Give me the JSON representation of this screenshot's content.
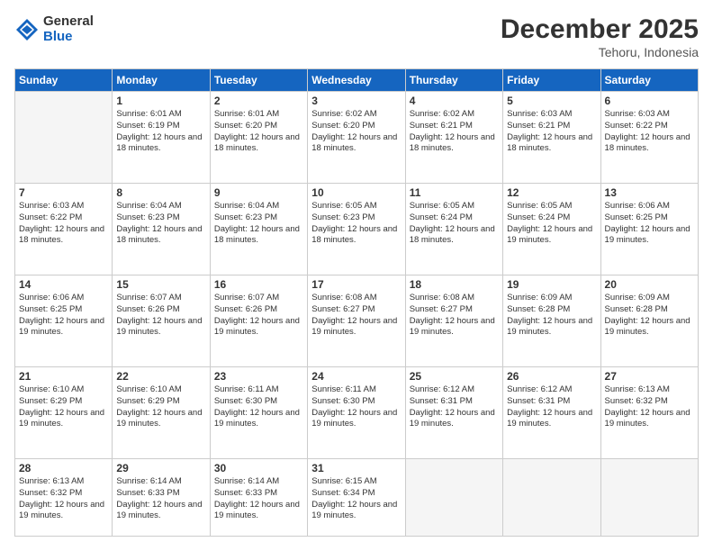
{
  "logo": {
    "general": "General",
    "blue": "Blue"
  },
  "header": {
    "month": "December 2025",
    "location": "Tehoru, Indonesia"
  },
  "days": [
    "Sunday",
    "Monday",
    "Tuesday",
    "Wednesday",
    "Thursday",
    "Friday",
    "Saturday"
  ],
  "weeks": [
    [
      {
        "num": "",
        "sunrise": "",
        "sunset": "",
        "daylight": ""
      },
      {
        "num": "1",
        "sunrise": "Sunrise: 6:01 AM",
        "sunset": "Sunset: 6:19 PM",
        "daylight": "Daylight: 12 hours and 18 minutes."
      },
      {
        "num": "2",
        "sunrise": "Sunrise: 6:01 AM",
        "sunset": "Sunset: 6:20 PM",
        "daylight": "Daylight: 12 hours and 18 minutes."
      },
      {
        "num": "3",
        "sunrise": "Sunrise: 6:02 AM",
        "sunset": "Sunset: 6:20 PM",
        "daylight": "Daylight: 12 hours and 18 minutes."
      },
      {
        "num": "4",
        "sunrise": "Sunrise: 6:02 AM",
        "sunset": "Sunset: 6:21 PM",
        "daylight": "Daylight: 12 hours and 18 minutes."
      },
      {
        "num": "5",
        "sunrise": "Sunrise: 6:03 AM",
        "sunset": "Sunset: 6:21 PM",
        "daylight": "Daylight: 12 hours and 18 minutes."
      },
      {
        "num": "6",
        "sunrise": "Sunrise: 6:03 AM",
        "sunset": "Sunset: 6:22 PM",
        "daylight": "Daylight: 12 hours and 18 minutes."
      }
    ],
    [
      {
        "num": "7",
        "sunrise": "Sunrise: 6:03 AM",
        "sunset": "Sunset: 6:22 PM",
        "daylight": "Daylight: 12 hours and 18 minutes."
      },
      {
        "num": "8",
        "sunrise": "Sunrise: 6:04 AM",
        "sunset": "Sunset: 6:23 PM",
        "daylight": "Daylight: 12 hours and 18 minutes."
      },
      {
        "num": "9",
        "sunrise": "Sunrise: 6:04 AM",
        "sunset": "Sunset: 6:23 PM",
        "daylight": "Daylight: 12 hours and 18 minutes."
      },
      {
        "num": "10",
        "sunrise": "Sunrise: 6:05 AM",
        "sunset": "Sunset: 6:23 PM",
        "daylight": "Daylight: 12 hours and 18 minutes."
      },
      {
        "num": "11",
        "sunrise": "Sunrise: 6:05 AM",
        "sunset": "Sunset: 6:24 PM",
        "daylight": "Daylight: 12 hours and 18 minutes."
      },
      {
        "num": "12",
        "sunrise": "Sunrise: 6:05 AM",
        "sunset": "Sunset: 6:24 PM",
        "daylight": "Daylight: 12 hours and 19 minutes."
      },
      {
        "num": "13",
        "sunrise": "Sunrise: 6:06 AM",
        "sunset": "Sunset: 6:25 PM",
        "daylight": "Daylight: 12 hours and 19 minutes."
      }
    ],
    [
      {
        "num": "14",
        "sunrise": "Sunrise: 6:06 AM",
        "sunset": "Sunset: 6:25 PM",
        "daylight": "Daylight: 12 hours and 19 minutes."
      },
      {
        "num": "15",
        "sunrise": "Sunrise: 6:07 AM",
        "sunset": "Sunset: 6:26 PM",
        "daylight": "Daylight: 12 hours and 19 minutes."
      },
      {
        "num": "16",
        "sunrise": "Sunrise: 6:07 AM",
        "sunset": "Sunset: 6:26 PM",
        "daylight": "Daylight: 12 hours and 19 minutes."
      },
      {
        "num": "17",
        "sunrise": "Sunrise: 6:08 AM",
        "sunset": "Sunset: 6:27 PM",
        "daylight": "Daylight: 12 hours and 19 minutes."
      },
      {
        "num": "18",
        "sunrise": "Sunrise: 6:08 AM",
        "sunset": "Sunset: 6:27 PM",
        "daylight": "Daylight: 12 hours and 19 minutes."
      },
      {
        "num": "19",
        "sunrise": "Sunrise: 6:09 AM",
        "sunset": "Sunset: 6:28 PM",
        "daylight": "Daylight: 12 hours and 19 minutes."
      },
      {
        "num": "20",
        "sunrise": "Sunrise: 6:09 AM",
        "sunset": "Sunset: 6:28 PM",
        "daylight": "Daylight: 12 hours and 19 minutes."
      }
    ],
    [
      {
        "num": "21",
        "sunrise": "Sunrise: 6:10 AM",
        "sunset": "Sunset: 6:29 PM",
        "daylight": "Daylight: 12 hours and 19 minutes."
      },
      {
        "num": "22",
        "sunrise": "Sunrise: 6:10 AM",
        "sunset": "Sunset: 6:29 PM",
        "daylight": "Daylight: 12 hours and 19 minutes."
      },
      {
        "num": "23",
        "sunrise": "Sunrise: 6:11 AM",
        "sunset": "Sunset: 6:30 PM",
        "daylight": "Daylight: 12 hours and 19 minutes."
      },
      {
        "num": "24",
        "sunrise": "Sunrise: 6:11 AM",
        "sunset": "Sunset: 6:30 PM",
        "daylight": "Daylight: 12 hours and 19 minutes."
      },
      {
        "num": "25",
        "sunrise": "Sunrise: 6:12 AM",
        "sunset": "Sunset: 6:31 PM",
        "daylight": "Daylight: 12 hours and 19 minutes."
      },
      {
        "num": "26",
        "sunrise": "Sunrise: 6:12 AM",
        "sunset": "Sunset: 6:31 PM",
        "daylight": "Daylight: 12 hours and 19 minutes."
      },
      {
        "num": "27",
        "sunrise": "Sunrise: 6:13 AM",
        "sunset": "Sunset: 6:32 PM",
        "daylight": "Daylight: 12 hours and 19 minutes."
      }
    ],
    [
      {
        "num": "28",
        "sunrise": "Sunrise: 6:13 AM",
        "sunset": "Sunset: 6:32 PM",
        "daylight": "Daylight: 12 hours and 19 minutes."
      },
      {
        "num": "29",
        "sunrise": "Sunrise: 6:14 AM",
        "sunset": "Sunset: 6:33 PM",
        "daylight": "Daylight: 12 hours and 19 minutes."
      },
      {
        "num": "30",
        "sunrise": "Sunrise: 6:14 AM",
        "sunset": "Sunset: 6:33 PM",
        "daylight": "Daylight: 12 hours and 19 minutes."
      },
      {
        "num": "31",
        "sunrise": "Sunrise: 6:15 AM",
        "sunset": "Sunset: 6:34 PM",
        "daylight": "Daylight: 12 hours and 19 minutes."
      },
      {
        "num": "",
        "sunrise": "",
        "sunset": "",
        "daylight": ""
      },
      {
        "num": "",
        "sunrise": "",
        "sunset": "",
        "daylight": ""
      },
      {
        "num": "",
        "sunrise": "",
        "sunset": "",
        "daylight": ""
      }
    ]
  ]
}
